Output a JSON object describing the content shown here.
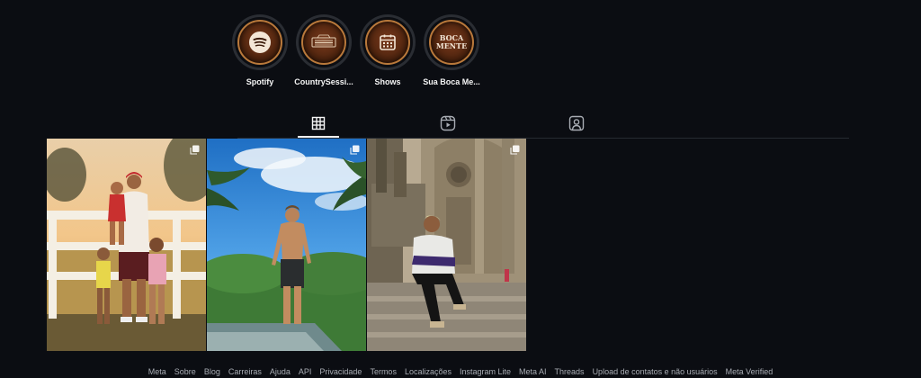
{
  "highlights": [
    {
      "label": "Spotify",
      "icon": "spotify-icon"
    },
    {
      "label": "CountrySessi...",
      "icon": "country-sessions-logo-icon"
    },
    {
      "label": "Shows",
      "icon": "calendar-icon"
    },
    {
      "label": "Sua Boca Me...",
      "icon": "sua-boca-mente-logo-icon",
      "logo_text_top": "BOCA",
      "logo_text_bottom": "MENTE"
    }
  ],
  "tabs": [
    {
      "name": "posts",
      "icon": "grid-icon",
      "active": true
    },
    {
      "name": "reels",
      "icon": "reels-icon",
      "active": false
    },
    {
      "name": "tagged",
      "icon": "tagged-user-icon",
      "active": false
    }
  ],
  "posts": [
    {
      "description": "family-photo",
      "multi": true
    },
    {
      "description": "beach-shirtless-photo",
      "multi": true
    },
    {
      "description": "cathedral-steps-photo",
      "multi": true
    }
  ],
  "footer": {
    "links": [
      "Meta",
      "Sobre",
      "Blog",
      "Carreiras",
      "Ajuda",
      "API",
      "Privacidade",
      "Termos",
      "Localizações",
      "Instagram Lite",
      "Meta AI",
      "Threads",
      "Upload de contatos e não usuários",
      "Meta Verified"
    ]
  },
  "colors": {
    "background": "#0b0d12",
    "text": "#f5f5f5",
    "footer_text": "#a8acb3",
    "highlight_gold": "#b9793b"
  }
}
